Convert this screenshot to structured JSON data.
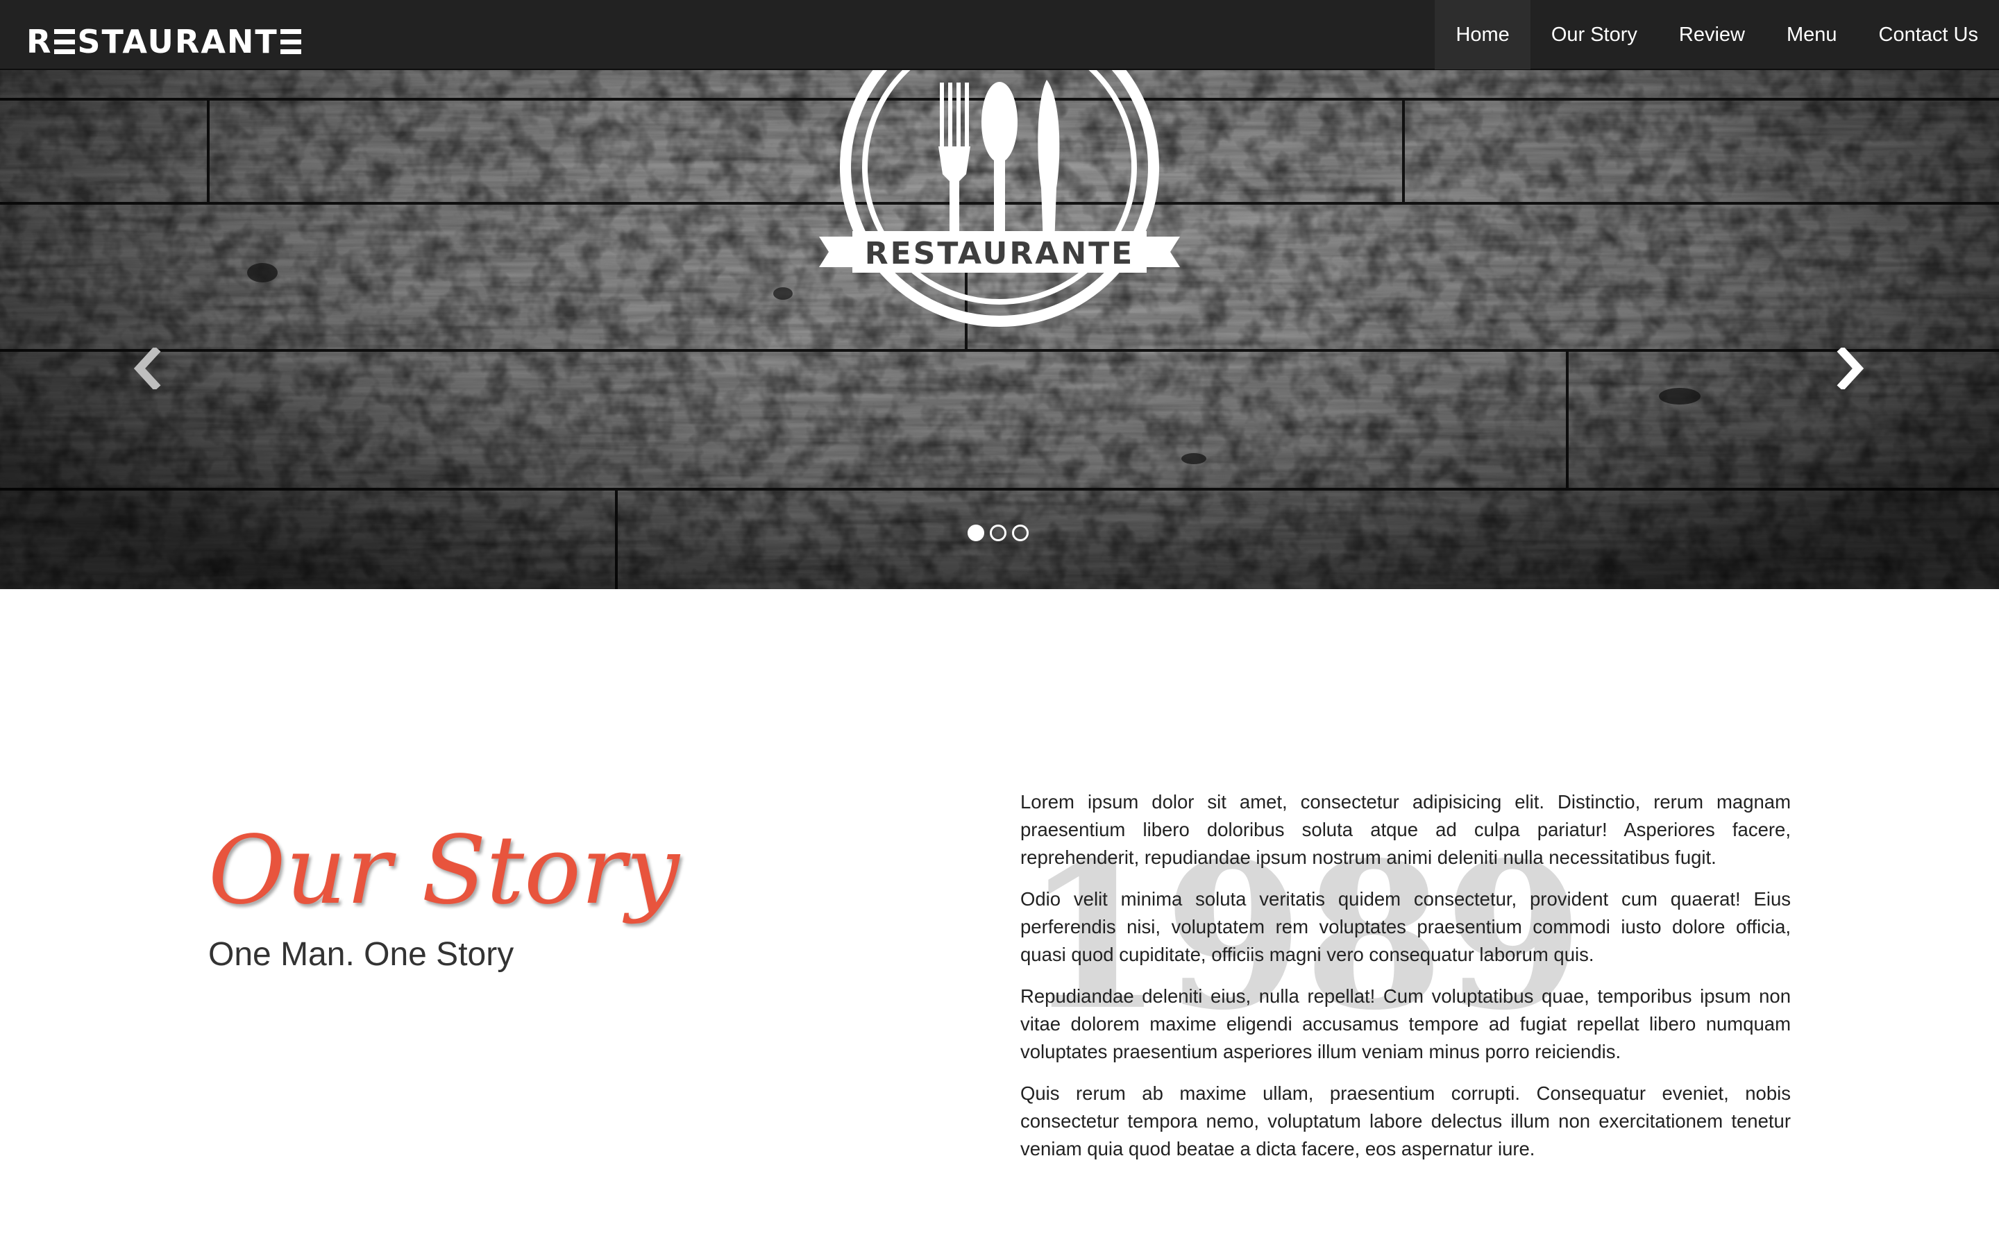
{
  "navbar": {
    "brand": "RESTAURANTE",
    "items": [
      {
        "label": "Home",
        "active": true
      },
      {
        "label": "Our Story",
        "active": false
      },
      {
        "label": "Review",
        "active": false
      },
      {
        "label": "Menu",
        "active": false
      },
      {
        "label": "Contact Us",
        "active": false
      }
    ]
  },
  "hero": {
    "badge_text": "RESTAURANTE",
    "slides_total": 3,
    "active_slide": 1,
    "prev_icon": "chevron-left-icon",
    "next_icon": "chevron-right-icon"
  },
  "story": {
    "title": "Our Story",
    "subtitle": "One Man. One Story",
    "year": "1989",
    "paragraphs": [
      "Lorem ipsum dolor sit amet, consectetur adipisicing elit. Distinctio, rerum magnam praesentium libero doloribus soluta atque ad culpa pariatur! Asperiores facere, reprehenderit, repudiandae ipsum nostrum animi deleniti nulla necessitatibus fugit.",
      "Odio velit minima soluta veritatis quidem consectetur, provident cum quaerat! Eius perferendis nisi, voluptatem rem voluptates praesentium commodi iusto dolore officia, quasi quod cupiditate, officiis magni vero consequatur laborum quis.",
      "Repudiandae deleniti eius, nulla repellat! Cum voluptatibus quae, temporibus ipsum non vitae dolorem maxime eligendi accusamus tempore ad fugiat repellat libero numquam voluptates praesentium asperiores illum veniam minus porro reiciendis.",
      "Quis rerum ab maxime ullam, praesentium corrupti. Consequatur eveniet, nobis consectetur tempora nemo, voluptatum labore delectus illum non exercitationem tenetur veniam quia quod beatae a dicta facere, eos aspernatur iure."
    ]
  },
  "colors": {
    "navbar_bg": "#222222",
    "accent": "#e8543d",
    "year_watermark": "#d9d9d9",
    "body_text": "#222222"
  }
}
